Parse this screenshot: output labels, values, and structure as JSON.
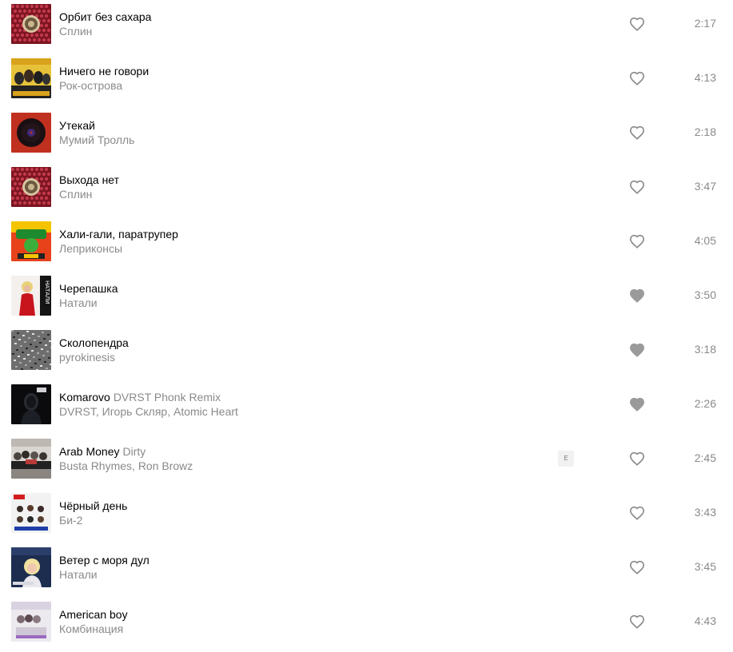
{
  "tracks": [
    {
      "title": "Орбит без сахара",
      "version": "",
      "artist": "Сплин",
      "duration": "2:17",
      "liked": false,
      "explicit": "",
      "cover": "dots-burgundy"
    },
    {
      "title": "Ничего не говори",
      "version": "",
      "artist": "Рок-острова",
      "duration": "4:13",
      "liked": false,
      "explicit": "",
      "cover": "band-yellow"
    },
    {
      "title": "Утекай",
      "version": "",
      "artist": "Мумий Тролль",
      "duration": "2:18",
      "liked": false,
      "explicit": "",
      "cover": "vinyl-red"
    },
    {
      "title": "Выхода нет",
      "version": "",
      "artist": "Сплин",
      "duration": "3:47",
      "liked": false,
      "explicit": "",
      "cover": "dots-burgundy"
    },
    {
      "title": "Хали-гали, паратрупер",
      "version": "",
      "artist": "Леприконсы",
      "duration": "4:05",
      "liked": false,
      "explicit": "",
      "cover": "cartoon-green"
    },
    {
      "title": "Черепашка",
      "version": "",
      "artist": "Натали",
      "duration": "3:50",
      "liked": true,
      "explicit": "",
      "cover": "singer-red"
    },
    {
      "title": "Сколопендра",
      "version": "",
      "artist": "pyrokinesis",
      "duration": "3:18",
      "liked": true,
      "explicit": "",
      "cover": "noise-grey"
    },
    {
      "title": "Komarovo",
      "version": "DVRST Phonk Remix",
      "artist": "DVRST, Игорь Скляр, Atomic Heart",
      "duration": "2:26",
      "liked": true,
      "explicit": "",
      "cover": "robot-dark"
    },
    {
      "title": "Arab Money",
      "version": "Dirty",
      "artist": "Busta Rhymes, Ron Browz",
      "duration": "2:45",
      "liked": false,
      "explicit": "E",
      "cover": "group-grey"
    },
    {
      "title": "Чёрный день",
      "version": "",
      "artist": "Би-2",
      "duration": "3:43",
      "liked": false,
      "explicit": "",
      "cover": "band-white"
    },
    {
      "title": "Ветер с моря дул",
      "version": "",
      "artist": "Натали",
      "duration": "3:45",
      "liked": false,
      "explicit": "",
      "cover": "blonde-navy"
    },
    {
      "title": "American boy",
      "version": "",
      "artist": "Комбинация",
      "duration": "4:43",
      "liked": false,
      "explicit": "",
      "cover": "group-light"
    }
  ],
  "colors": {
    "heart_outline": "#8a8a8a",
    "heart_filled": "#9a9a9a",
    "secondary_text": "#8a8a8a"
  }
}
